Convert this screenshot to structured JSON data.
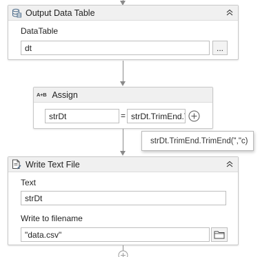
{
  "output_data_table": {
    "title": "Output Data Table",
    "icon": "datatable-icon",
    "field_label": "DataTable",
    "field_value": "dt",
    "browse_label": "..."
  },
  "assign": {
    "title": "Assign",
    "icon_text": "A+B",
    "to_value": "strDt",
    "equals": "=",
    "value": "strDt.TrimEnd.T"
  },
  "tooltip": {
    "text": "strDt.TrimEnd.TrimEnd(\",\"c)"
  },
  "write_text_file": {
    "title": "Write Text File",
    "icon": "write-file-icon",
    "text_label": "Text",
    "text_value": "strDt",
    "filename_label": "Write to filename",
    "filename_value": "\"data.csv\""
  }
}
